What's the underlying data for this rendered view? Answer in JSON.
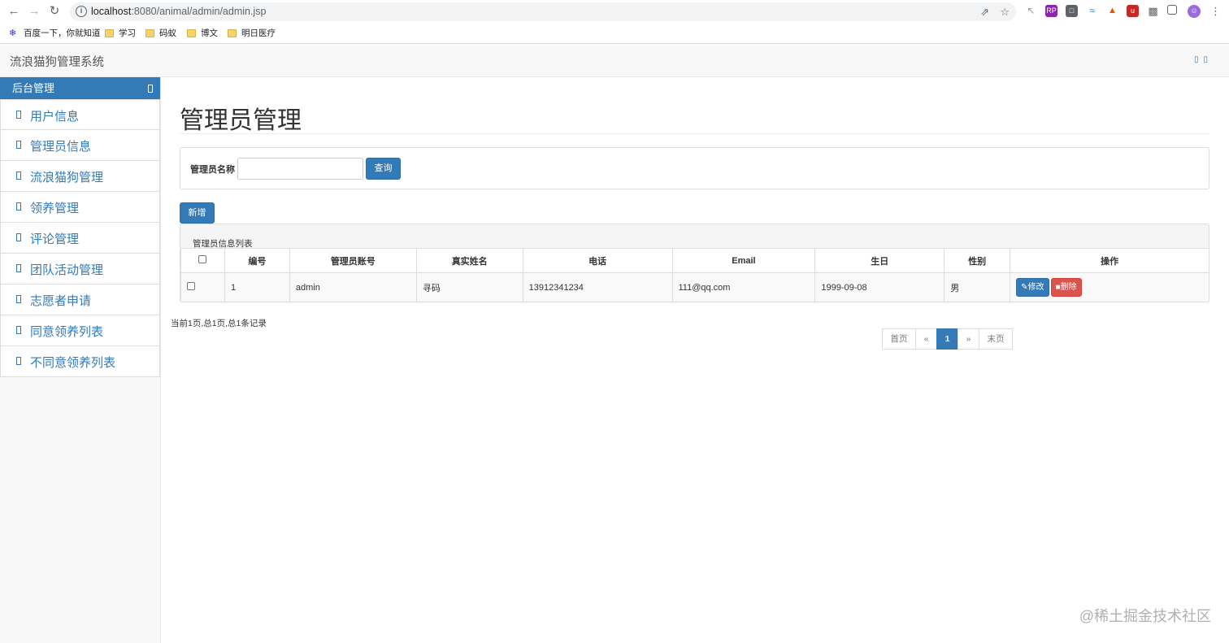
{
  "browser": {
    "url_host": "localhost",
    "url_rest": ":8080/animal/admin/admin.jsp",
    "bookmarks": [
      "百度一下，你就知道",
      "学习",
      "码蚁",
      "博文",
      "明日医疗"
    ]
  },
  "app": {
    "brand": "流浪猫狗管理系统",
    "sidebar": {
      "header": "后台管理",
      "items": [
        "用户信息",
        "管理员信息",
        "流浪猫狗管理",
        "领养管理",
        "评论管理",
        "团队活动管理",
        "志愿者申请",
        "同意领养列表",
        "不同意领养列表"
      ]
    },
    "main": {
      "title": "管理员管理",
      "search": {
        "label": "管理员名称",
        "value": "",
        "button": "查询"
      },
      "add_button": "新增",
      "table": {
        "caption": "管理员信息列表",
        "headers": [
          "编号",
          "管理员账号",
          "真实姓名",
          "电话",
          "Email",
          "生日",
          "性别",
          "操作"
        ],
        "rows": [
          {
            "id": "1",
            "account": "admin",
            "name": "寻码",
            "phone": "13912341234",
            "email": "111@qq.com",
            "birthday": "1999-09-08",
            "gender": "男",
            "edit": "修改",
            "delete": "删除"
          }
        ]
      },
      "page_info": "当前1页,总1页,总1条记录",
      "pager": {
        "first": "首页",
        "prev": "«",
        "current": "1",
        "next": "»",
        "last": "末页"
      }
    }
  },
  "watermark": "@稀土掘金技术社区",
  "colors": {
    "primary": "#337ab7",
    "danger": "#d9534f",
    "navbar_bg": "#f8f8f8"
  }
}
